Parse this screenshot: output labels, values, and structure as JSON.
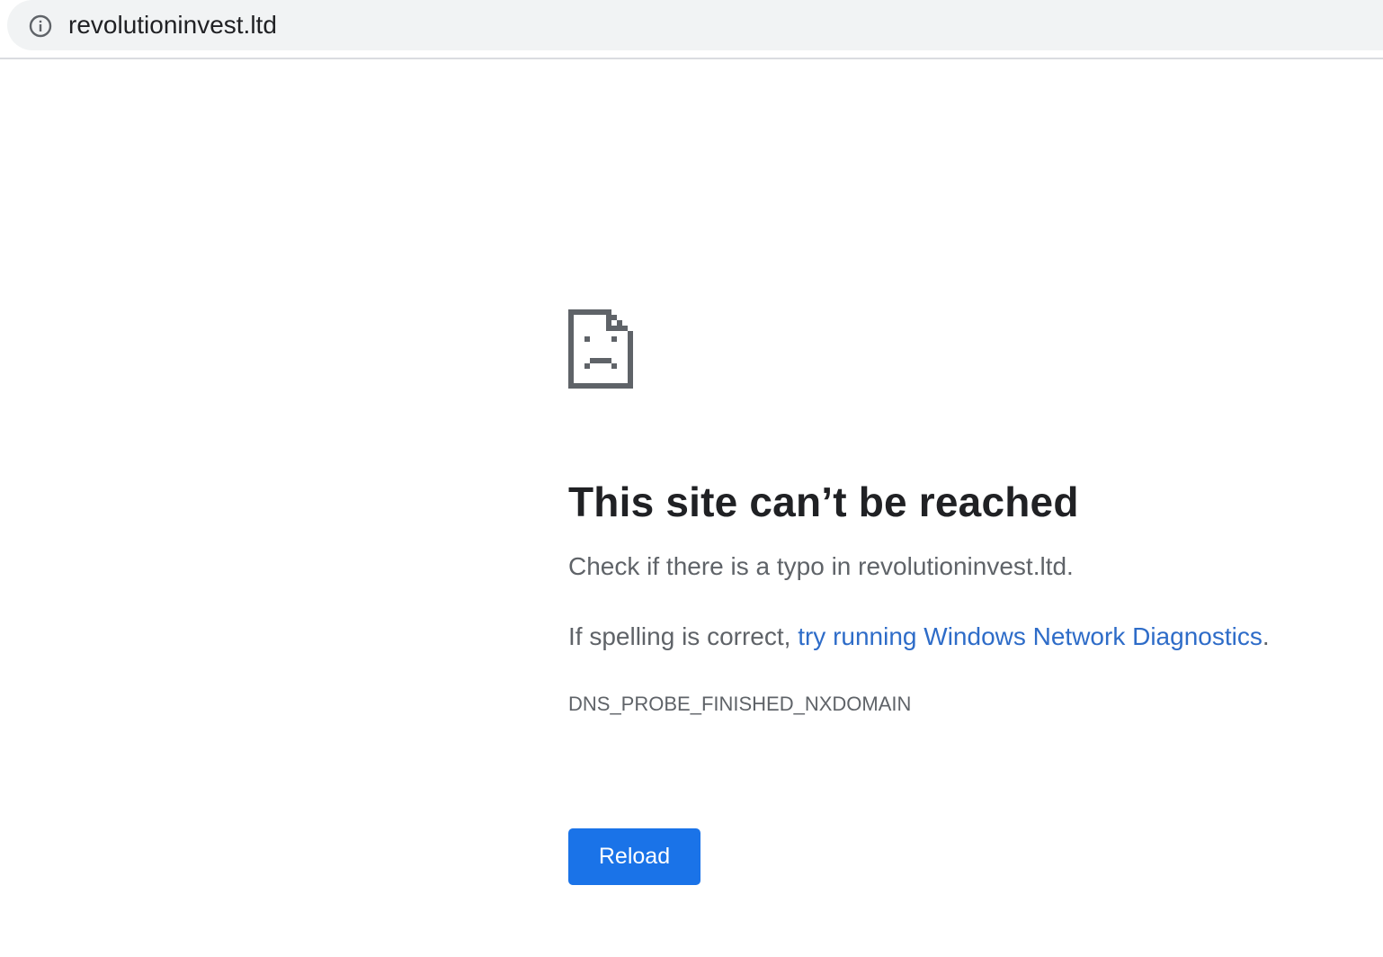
{
  "address_bar": {
    "url": "revolutioninvest.ltd",
    "icon": "info-icon"
  },
  "error_page": {
    "icon": "sad-document-icon",
    "heading": "This site can’t be reached",
    "typo_message": "Check if there is a typo in revolutioninvest.ltd.",
    "spelling_prefix": "If spelling is correct, ",
    "diagnostics_link": "try running Windows Network Diagnostics",
    "spelling_suffix": ".",
    "error_code": "DNS_PROBE_FINISHED_NXDOMAIN",
    "reload_label": "Reload"
  },
  "colors": {
    "accent": "#1a73e8",
    "link": "#2e6cc8",
    "heading_text": "#202124",
    "body_text": "#5f6368",
    "omnibox_bg": "#f1f3f4"
  }
}
